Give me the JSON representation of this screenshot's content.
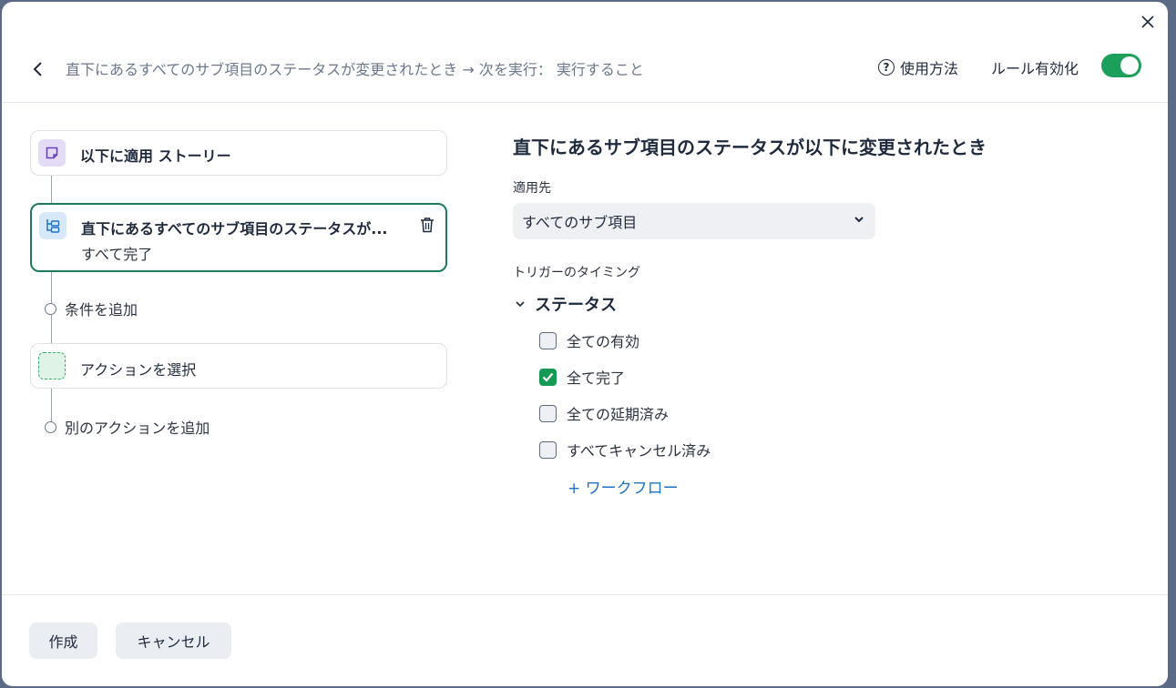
{
  "header": {
    "breadcrumb": "直下にあるすべてのサブ項目のステータスが変更されたとき → 次を実行： 実行すること",
    "help_label": "使用方法",
    "help_icon_glyph": "?",
    "rule_enabled_label": "ルール有効化",
    "rule_enabled": true
  },
  "workflow": {
    "apply_card": {
      "title": "以下に適用 ストーリー"
    },
    "trigger_card": {
      "title": "直下にあるすべてのサブ項目のステータスが...",
      "subtitle": "すべて完了"
    },
    "add_condition": "条件を追加",
    "action_card": {
      "title": "アクションを選択"
    },
    "add_action": "別のアクションを追加"
  },
  "panel": {
    "title": "直下にあるサブ項目のステータスが以下に変更されたとき",
    "apply_to_label": "適用先",
    "apply_to_value": "すべてのサブ項目",
    "trigger_timing_label": "トリガーのタイミング",
    "section_title": "ステータス",
    "options": [
      {
        "label": "全ての有効",
        "checked": false
      },
      {
        "label": "全て完了",
        "checked": true
      },
      {
        "label": "全ての延期済み",
        "checked": false
      },
      {
        "label": "すべてキャンセル済み",
        "checked": false
      }
    ],
    "workflow_link": "+ ワークフロー"
  },
  "footer": {
    "create_label": "作成",
    "cancel_label": "キャンセル"
  },
  "colors": {
    "accent_green": "#1aa05a",
    "selected_border": "#1e7a5a",
    "link_blue": "#1f72c4"
  }
}
